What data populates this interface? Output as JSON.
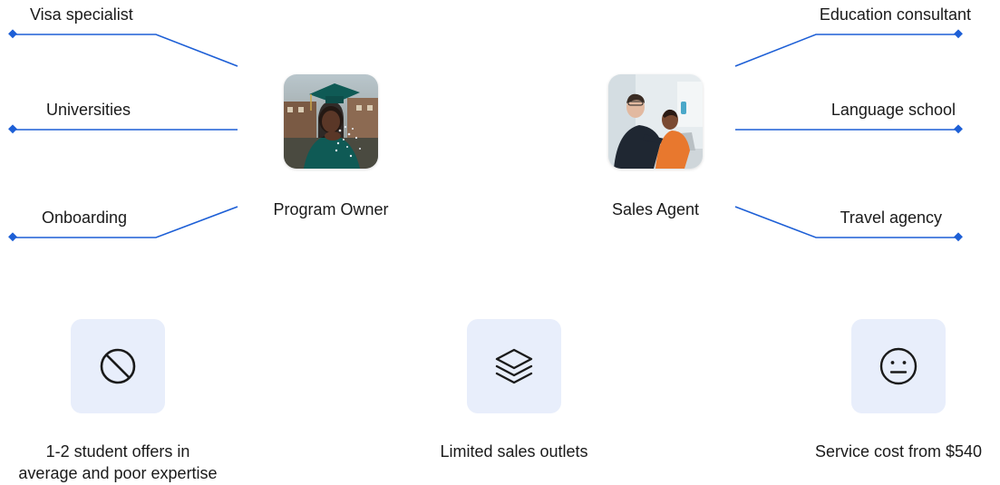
{
  "accent_color": "#1d5fd6",
  "left_group": {
    "labels": [
      "Visa specialist",
      "Universities",
      "Onboarding"
    ],
    "caption": "Program Owner",
    "image": "graduate-photo"
  },
  "right_group": {
    "labels": [
      "Education consultant",
      "Language school",
      "Travel agency"
    ],
    "caption": "Sales Agent",
    "image": "sales-agents-photo"
  },
  "features": [
    {
      "icon": "prohibited-icon",
      "lines": [
        "1-2 student offers in",
        "average and poor expertise"
      ]
    },
    {
      "icon": "layers-icon",
      "lines": [
        "Limited sales outlets"
      ]
    },
    {
      "icon": "neutral-face-icon",
      "lines": [
        "Service cost from $540"
      ]
    }
  ]
}
